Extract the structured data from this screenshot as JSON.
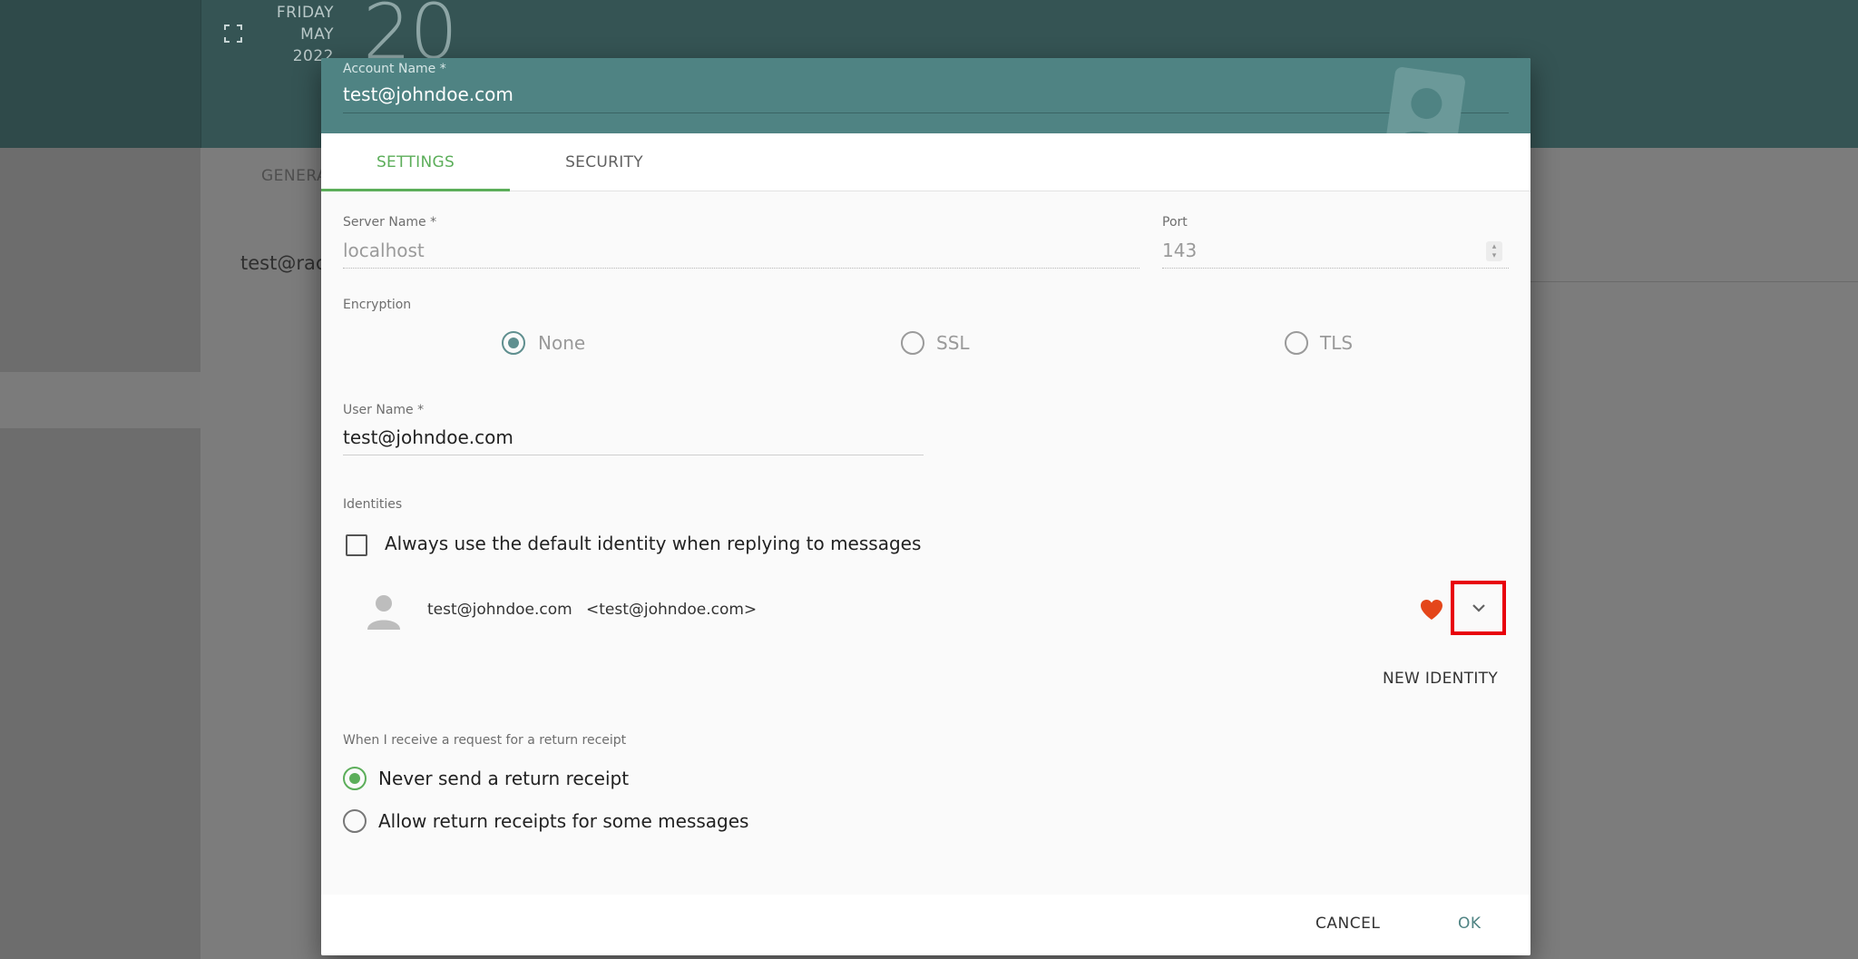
{
  "background": {
    "date": {
      "weekday": "FRIDAY",
      "month": "MAY",
      "year": "2022",
      "day": "20"
    },
    "tab_general": "GENERA",
    "account_text": "test@rach"
  },
  "dialog": {
    "account_name": {
      "label": "Account Name *",
      "value": "test@johndoe.com"
    },
    "tabs": [
      {
        "label": "SETTINGS",
        "active": true
      },
      {
        "label": "SECURITY",
        "active": false
      }
    ],
    "server_name": {
      "label": "Server Name *",
      "value": "localhost"
    },
    "port": {
      "label": "Port",
      "value": "143"
    },
    "encryption": {
      "label": "Encryption",
      "options": [
        {
          "label": "None",
          "selected": true
        },
        {
          "label": "SSL",
          "selected": false
        },
        {
          "label": "TLS",
          "selected": false
        }
      ]
    },
    "user_name": {
      "label": "User Name *",
      "value": "test@johndoe.com"
    },
    "identities": {
      "label": "Identities",
      "default_identity_checkbox": {
        "label": "Always use the default identity when replying to messages",
        "checked": false
      },
      "items": [
        {
          "name": "test@johndoe.com",
          "address": "<test@johndoe.com>",
          "favorite": true
        }
      ],
      "new_identity_label": "NEW IDENTITY"
    },
    "return_receipt": {
      "label": "When I receive a request for a return receipt",
      "options": [
        {
          "label": "Never send a return receipt",
          "selected": true
        },
        {
          "label": "Allow return receipts for some messages",
          "selected": false
        }
      ]
    },
    "footer": {
      "cancel_label": "CANCEL",
      "ok_label": "OK"
    }
  },
  "colors": {
    "header_teal": "#4f8383",
    "accent_green": "#5cae5a",
    "favorite_red": "#e4461a",
    "highlight_box": "#e8000b"
  }
}
